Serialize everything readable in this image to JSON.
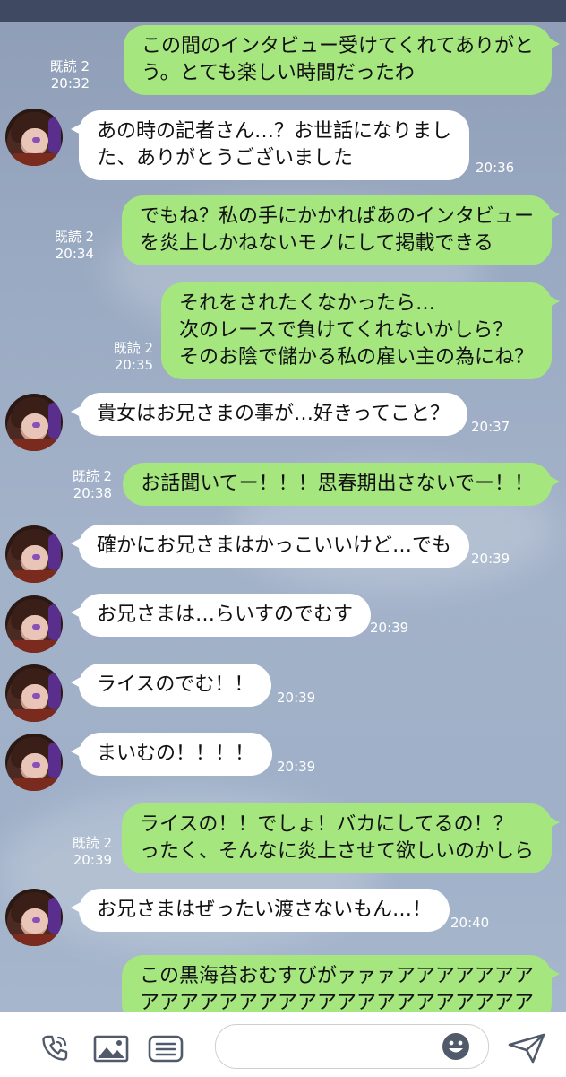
{
  "read_label": "既読 2",
  "messages": [
    {
      "side": "me",
      "text": "この間のインタビュー受けてくれてありがと\nう。とても楽しい時間だったわ",
      "time": "20:32"
    },
    {
      "side": "them",
      "text": "あの時の記者さん…？お世話になりまし\nた、ありがとうございました",
      "time": "20:36"
    },
    {
      "side": "me",
      "text": "でもね？私の手にかかればあのインタビュー\nを炎上しかねないモノにして掲載できる",
      "time": "20:34"
    },
    {
      "side": "me",
      "text": "それをされたくなかったら…\n次のレースで負けてくれないかしら？\nそのお陰で儲かる私の雇い主の為にね？",
      "time": "20:35"
    },
    {
      "side": "them",
      "text": "貴女はお兄さまの事が…好きってこと？",
      "time": "20:37"
    },
    {
      "side": "me",
      "text": "お話聞いてー！！！思春期出さないでー！！",
      "time": "20:38"
    },
    {
      "side": "them",
      "text": "確かにお兄さまはかっこいいけど…でも",
      "time": "20:39"
    },
    {
      "side": "them",
      "text": "お兄さまは…らいすのでむす",
      "time": "20:39"
    },
    {
      "side": "them",
      "text": "ライスのでむ！！",
      "time": "20:39"
    },
    {
      "side": "them",
      "text": "まいむの！！！！",
      "time": "20:39"
    },
    {
      "side": "me",
      "text": "ライスの！！でしょ！バカにしてるの！？\nったく、そんなに炎上させて欲しいのかしら",
      "time": "20:39"
    },
    {
      "side": "them",
      "text": "お兄さまはぜったい渡さないもん…！",
      "time": "20:40"
    },
    {
      "side": "me",
      "text": "この黒海苔おむすびがァァァアアアアアアア\nアアアアアアアアアアアアアアアアアアアア",
      "time": ""
    }
  ],
  "input": {
    "placeholder": "",
    "value": ""
  },
  "icons": {
    "call": "phone-icon",
    "image": "image-icon",
    "menu": "menu-icon",
    "emoji": "emoji-icon",
    "send": "send-icon"
  },
  "colors": {
    "my_bubble": "#a5e67f",
    "their_bubble": "#ffffff",
    "footer": "#ffffff"
  }
}
